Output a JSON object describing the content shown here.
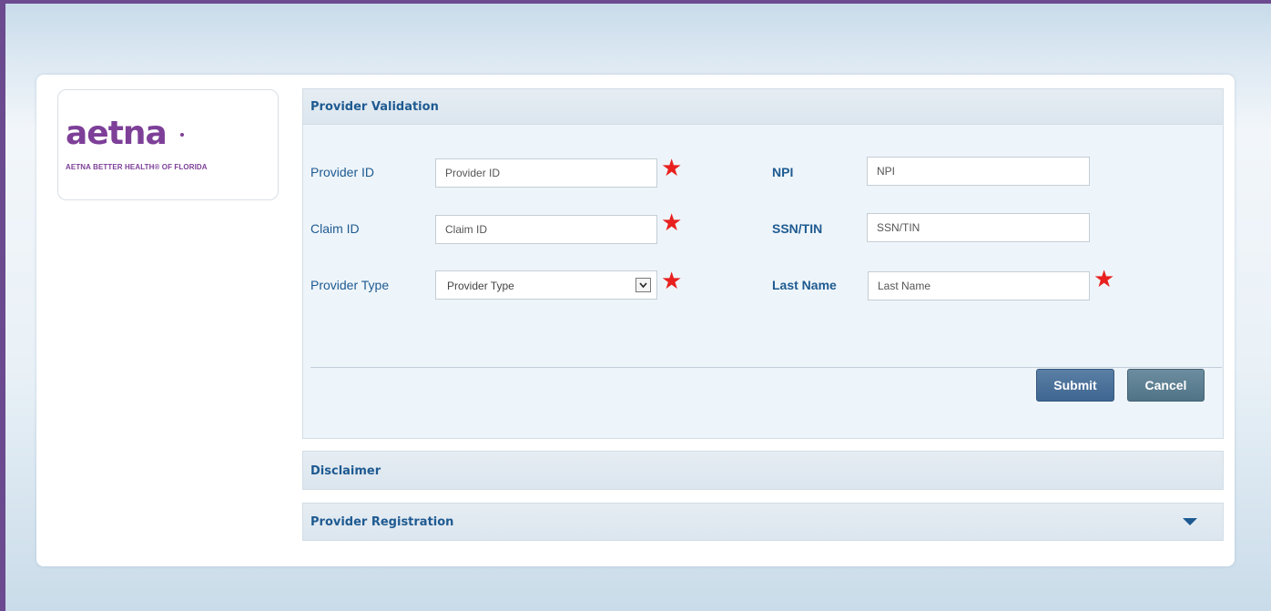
{
  "brand": {
    "logo_word": "aetna",
    "logo_tagline": "AETNA BETTER HEALTH® OF FLORIDA",
    "color": "#7d3f98"
  },
  "provider_validation": {
    "title": "Provider Validation",
    "fields": {
      "provider_id": {
        "label": "Provider ID",
        "placeholder": "Provider ID",
        "required": true
      },
      "claim_id": {
        "label": "Claim ID",
        "placeholder": "Claim ID",
        "required": true
      },
      "provider_type": {
        "label": "Provider Type",
        "selected": "Provider Type",
        "required": true
      },
      "npi": {
        "label": "NPI",
        "placeholder": "NPI",
        "required": false
      },
      "ssn_tin": {
        "label": "SSN/TIN",
        "placeholder": "SSN/TIN",
        "required": false
      },
      "last_name": {
        "label": "Last Name",
        "placeholder": "Last Name",
        "required": true
      }
    },
    "buttons": {
      "submit": "Submit",
      "cancel": "Cancel"
    }
  },
  "disclaimer": {
    "title": "Disclaimer"
  },
  "provider_registration": {
    "title": "Provider Registration",
    "icon": "chevron-down-icon"
  },
  "required_marker": "★",
  "colors": {
    "heading": "#1e5a91",
    "required": "#e8211f",
    "frame": "#6b4a8f"
  }
}
